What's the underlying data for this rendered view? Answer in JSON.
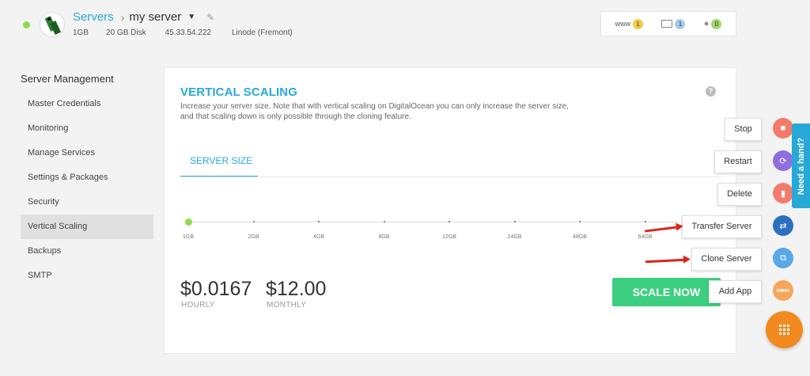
{
  "header": {
    "breadcrumb_root": "Servers",
    "server_name": "my server",
    "meta": {
      "ram": "1GB",
      "disk": "20 GB Disk",
      "ip": "45.33.54.222",
      "provider": "Linode (Fremont)"
    },
    "stats": {
      "www_label": "www",
      "www_count": "1",
      "folder_count": "1",
      "user_count": "0"
    }
  },
  "sidebar": {
    "title": "Server Management",
    "items": [
      {
        "label": "Master Credentials"
      },
      {
        "label": "Monitoring"
      },
      {
        "label": "Manage Services"
      },
      {
        "label": "Settings & Packages"
      },
      {
        "label": "Security"
      },
      {
        "label": "Vertical Scaling"
      },
      {
        "label": "Backups"
      },
      {
        "label": "SMTP"
      }
    ]
  },
  "main": {
    "title": "VERTICAL SCALING",
    "description": "Increase your server size. Note that with vertical scaling on DigitalOcean you can only increase the server size, and that scaling down is only possible through the cloning feature.",
    "tab_label": "SERVER SIZE",
    "sizes": [
      "1GB",
      "2GB",
      "4GB",
      "8GB",
      "12GB",
      "24GB",
      "48GB",
      "64GB"
    ],
    "selected_size": "1GB",
    "hourly_price": "$0.0167",
    "hourly_label": "HOURLY",
    "monthly_price": "$12.00",
    "monthly_label": "MONTHLY",
    "scale_button": "SCALE NOW"
  },
  "fab_menu": {
    "stop": "Stop",
    "restart": "Restart",
    "delete": "Delete",
    "transfer": "Transfer Server",
    "clone": "Clone Server",
    "add_app": "Add App",
    "www_glyph": "www",
    "colors": {
      "stop": "#f47b6b",
      "restart": "#8f6fe0",
      "delete": "#f47b6b",
      "transfer": "#2d6fbf",
      "clone": "#5aa7e6",
      "add_app": "#f6a65a",
      "main": "#f28a1f"
    }
  },
  "help_tab": "Need a hand?"
}
